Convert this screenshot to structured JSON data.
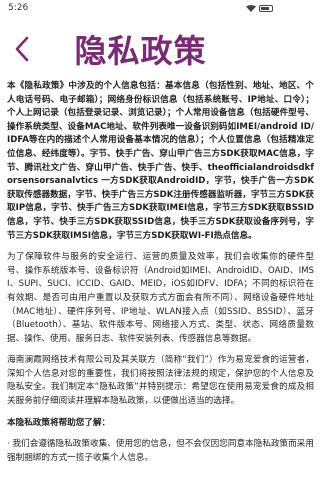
{
  "status_bar": {
    "time": "5:26"
  },
  "header": {
    "title": "隐私政策"
  },
  "paragraphs": [
    {
      "bold": true,
      "text": "本《隐私政策》中涉及的个人信息包括：基本信息（包括性别、地址、地区、个人电话号码、电子邮箱）；网络身份标识信息（包括系统账号、IP地址、口令）；个人上网记录（包括登录记录、浏览记录）；个人常用设备信息（包括硬件型号、操作系统类型、设备MAC地址、软件列表唯一设备识别码如IMEI/android ID/IDFA等在内的描述个人常用设备基本情况的信息）；个人位置信息（包括精准定位信息、经纬度等）。字节、快手广告、穿山甲广告三方SDK获取MAC信息，字节、腾讯社文广告、穿山甲广告、快手广告、快手、theofficialandroidsdkforsensorsanalvtics 一方SDK获取AndroidID，字节，快手广告一方SDK获取传感器数据，字节、快手广告三方SDK注册传感器监听器，字节三方SDK获取IP信息，字节、快手广告三方SDK获取IMEI信息，字节三方SDK获取BSSID信息，字节、快手三方SDK获取SSID信息，快手三方SDK获取设备序列号，字节三方SDK获取IMSI信息，字节三方SDK获取WI-FI热点信息。"
    },
    {
      "bold": false,
      "text": "为了保障软件与服务的安全运行、运营的质量及效率，我们会收集你的硬件型号、操作系统版本号、设备标识符（Android如IMEI、AndroidID、OAID、IMSI、SUPI、SUCI、ICCID、GAID、MEID，iOS如IDFV、IDFA；不同的标识符在有效期、是否可由用户重置以及获取方式方面会有所不同）、网络设备硬件地址（MAC地址）、硬件序列号、IP地址、WLAN接入点（如SSID、BSSID）、蓝牙（Bluetooth）、基站、软件版本号、网络接入方式、类型、状态、网络质量数据、操作、使用、服务日志、软件安装列表、传感器信息等数据。"
    },
    {
      "bold": false,
      "text": "海南澜霞网络技术有限公司及其关联方（简称“我们”）作为易宠爱食的运营者，深知个人信息对您的重要性，我们将按照法律法规的规定，保护您的个人信息及隐私安全。我们制定本“隐私政策”并特别提示：希望您在使用易宠爱食的成及相关服务前仔细阅读并理解本隐私政策，以便做出适当的选择。"
    },
    {
      "bold": true,
      "text": "本隐私政策将帮助您了解："
    },
    {
      "bold": false,
      "text": "· 我们会遵循隐私政策收集、使用您的信息，但不会仅因您同意本隐私政策而采用强制捆绑的方式一揽子收集个人信息。"
    }
  ]
}
